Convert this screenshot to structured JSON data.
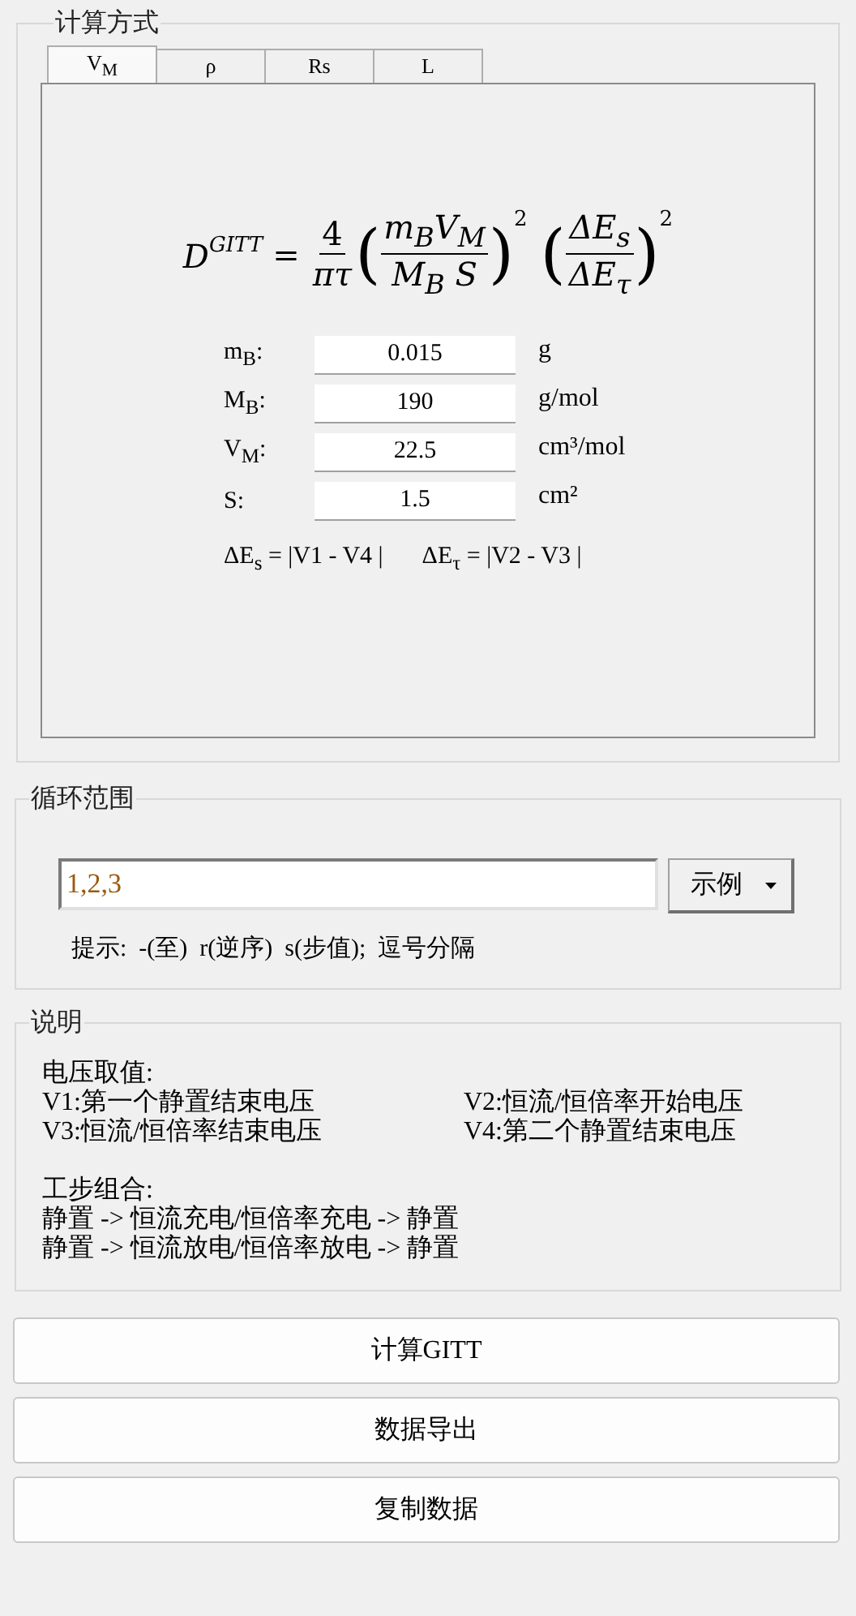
{
  "calc_group": {
    "title": "计算方式",
    "tabs": [
      {
        "label": "V$_{M}$",
        "selected": true
      },
      {
        "label": "ρ",
        "selected": false
      },
      {
        "label": "Rs",
        "selected": false
      },
      {
        "label": "L",
        "selected": false
      }
    ],
    "formula": {
      "lhs": "D",
      "lhs_sup": "GITT",
      "equals": "=",
      "frac1_num": "4",
      "frac1_den": "πτ",
      "open": "(",
      "frac2_num": "m$_{B}$V$_{M}$",
      "frac2_den": "M$_{B}$ S",
      "close": ")",
      "power1": "2",
      "frac3_num": "ΔE$_{s}$",
      "frac3_den": "ΔE$_{τ}$",
      "power2": "2"
    },
    "params": [
      {
        "label": "m$_{B}$:",
        "value": "0.015",
        "unit": "g"
      },
      {
        "label": "M$_{B}$:",
        "value": "190",
        "unit": "g/mol"
      },
      {
        "label": "V$_{M}$:",
        "value": "22.5",
        "unit": "cm³/mol"
      },
      {
        "label": "S:",
        "value": "1.5",
        "unit": "cm²"
      }
    ],
    "deltas": [
      "ΔE$_{s}$ = |V1 - V4 |",
      "ΔE$_{τ}$ = |V2 - V3 |"
    ]
  },
  "cycle_group": {
    "title": "循环范围",
    "value": "1,2,3",
    "example_button": "示例",
    "hint": "提示:  -(至)  r(逆序)  s(步值);  逗号分隔"
  },
  "notes_group": {
    "title": "说明",
    "voltage_title": "电压取值:",
    "voltage_items": [
      "V1:第一个静置结束电压",
      "V2:恒流/恒倍率开始电压",
      "V3:恒流/恒倍率结束电压",
      "V4:第二个静置结束电压"
    ],
    "steps_title": "工步组合:",
    "steps": [
      "静置 -> 恒流充电/恒倍率充电 -> 静置",
      "静置 -> 恒流放电/恒倍率放电 -> 静置"
    ]
  },
  "buttons": [
    "计算GITT",
    "数据导出",
    "复制数据"
  ]
}
